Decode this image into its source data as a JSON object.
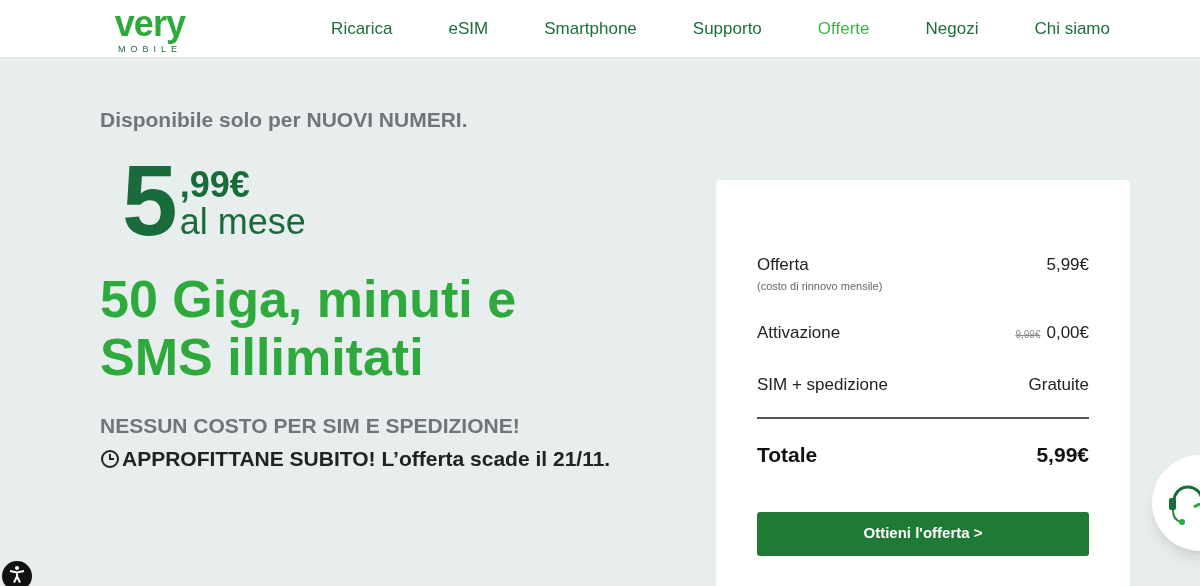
{
  "logo": {
    "name": "very",
    "tagline": "MOBILE"
  },
  "nav": [
    {
      "label": "Ricarica",
      "selected": false
    },
    {
      "label": "eSIM",
      "selected": false
    },
    {
      "label": "Smartphone",
      "selected": false
    },
    {
      "label": "Supporto",
      "selected": false
    },
    {
      "label": "Offerte",
      "selected": true
    },
    {
      "label": "Negozi",
      "selected": false
    },
    {
      "label": "Chi siamo",
      "selected": false
    }
  ],
  "hero": {
    "availability": "Disponibile solo per **NUOVI NUMERI**.",
    "price_main": "5",
    "price_cents": ",99€",
    "price_period": "al mese",
    "headline": "50 Giga, minuti e SMS illimitati",
    "note": "NESSUN COSTO PER SIM E SPEDIZIONE!",
    "deadline": "APPROFITTANE SUBITO! L’offerta scade il 21/11."
  },
  "summary": {
    "rows": [
      {
        "label": "Offerta",
        "sublabel": "(costo di rinnovo mensile)",
        "value": "5,99€"
      },
      {
        "label": "Attivazione",
        "old_value": "9,99€",
        "value": "0,00€"
      },
      {
        "label": "SIM + spedizione",
        "value": "Gratuite"
      }
    ],
    "total_label": "Totale",
    "total_value": "5,99€",
    "button": "Ottieni l'offerta >"
  }
}
